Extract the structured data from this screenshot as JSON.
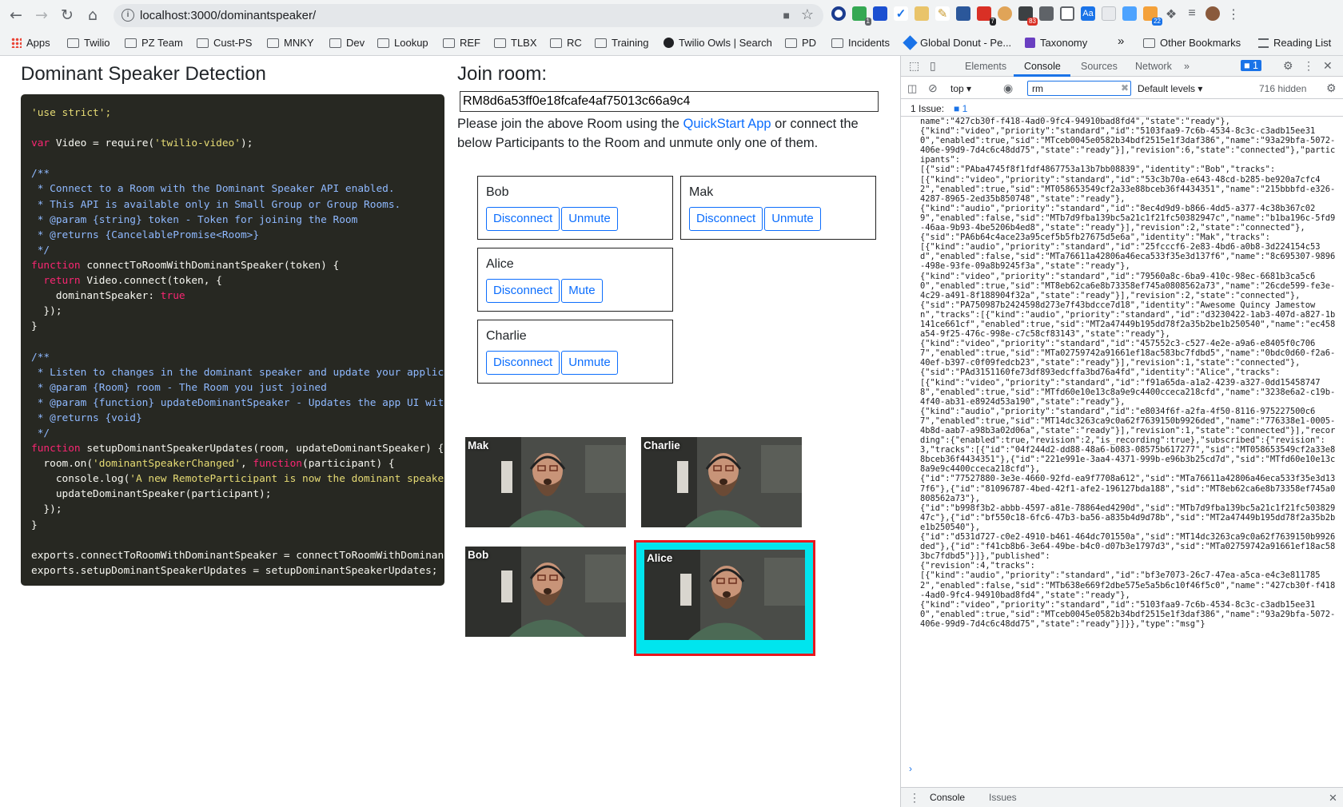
{
  "browser": {
    "url": "localhost:3000/dominantspeaker/",
    "bookmarks": [
      "Apps",
      "Twilio",
      "PZ Team",
      "Cust-PS",
      "MNKY",
      "Dev",
      "Lookup",
      "REF",
      "TLBX",
      "RC",
      "Training",
      "Twilio Owls | Search",
      "PD",
      "Incidents",
      "Global Donut - Pe...",
      "Taxonomy"
    ],
    "bookmarks_right": {
      "overflow": "»",
      "other": "Other Bookmarks",
      "reading": "Reading List"
    },
    "extension_badges": {
      "calendar": "83",
      "todo": "7",
      "rss": "22",
      "ext1": "1"
    }
  },
  "page": {
    "title": "Dominant Speaker Detection",
    "code": [
      [
        [
          "str",
          "'use strict';"
        ]
      ],
      [],
      [
        [
          "kw",
          "var "
        ],
        [
          "plain",
          "Video = "
        ],
        [
          "plain",
          "require("
        ],
        [
          "str",
          "'twilio-video'"
        ],
        [
          "plain",
          ");"
        ]
      ],
      [],
      [
        [
          "com",
          "/**"
        ]
      ],
      [
        [
          "com",
          " * Connect to a Room with the Dominant Speaker API enabled."
        ]
      ],
      [
        [
          "com",
          " * This API is available only in Small Group or Group Rooms."
        ]
      ],
      [
        [
          "com",
          " * @param {string} token - Token for joining the Room"
        ]
      ],
      [
        [
          "com",
          " * @returns {CancelablePromise<Room>}"
        ]
      ],
      [
        [
          "com",
          " */"
        ]
      ],
      [
        [
          "kw",
          "function "
        ],
        [
          "plain",
          "connectToRoomWithDominantSpeaker(token) {"
        ]
      ],
      [
        [
          "kw",
          "  return "
        ],
        [
          "plain",
          "Video.connect(token, {"
        ]
      ],
      [
        [
          "plain",
          "    dominantSpeaker: "
        ],
        [
          "kw",
          "true"
        ]
      ],
      [
        [
          "plain",
          "  });"
        ]
      ],
      [
        [
          "plain",
          "}"
        ]
      ],
      [],
      [
        [
          "com",
          "/**"
        ]
      ],
      [
        [
          "com",
          " * Listen to changes in the dominant speaker and update your application."
        ]
      ],
      [
        [
          "com",
          " * @param {Room} room - The Room you just joined"
        ]
      ],
      [
        [
          "com",
          " * @param {function} updateDominantSpeaker - Updates the app UI with the new dominant speaker"
        ]
      ],
      [
        [
          "com",
          " * @returns {void}"
        ]
      ],
      [
        [
          "com",
          " */"
        ]
      ],
      [
        [
          "kw",
          "function "
        ],
        [
          "plain",
          "setupDominantSpeakerUpdates(room, updateDominantSpeaker) {"
        ]
      ],
      [
        [
          "plain",
          "  room.on("
        ],
        [
          "str",
          "'dominantSpeakerChanged'"
        ],
        [
          "plain",
          ", "
        ],
        [
          "kw",
          "function"
        ],
        [
          "plain",
          "(participant) {"
        ]
      ],
      [
        [
          "plain",
          "    console.log("
        ],
        [
          "str",
          "'A new RemoteParticipant is now the dominant speaker:'"
        ],
        [
          "plain",
          ", participant);"
        ]
      ],
      [
        [
          "plain",
          "    updateDominantSpeaker(participant);"
        ]
      ],
      [
        [
          "plain",
          "  });"
        ]
      ],
      [
        [
          "plain",
          "}"
        ]
      ],
      [],
      [
        [
          "plain",
          "exports.connectToRoomWithDominantSpeaker = connectToRoomWithDominantSpeaker;"
        ]
      ],
      [
        [
          "plain",
          "exports.setupDominantSpeakerUpdates = setupDominantSpeakerUpdates;"
        ]
      ]
    ],
    "join": {
      "title": "Join room:",
      "room_sid": "RM8d6a53ff0e18fcafe4af75013c66a9c4",
      "help_before": "Please join the above Room using the ",
      "help_link": "QuickStart App",
      "help_after": " or connect the below Participants to the Room and unmute only one of them."
    },
    "participants": [
      {
        "name": "Bob",
        "disconnect": "Disconnect",
        "toggle": "Unmute"
      },
      {
        "name": "Mak",
        "disconnect": "Disconnect",
        "toggle": "Unmute"
      },
      {
        "name": "Alice",
        "disconnect": "Disconnect",
        "toggle": "Mute"
      },
      {
        "name": "Charlie",
        "disconnect": "Disconnect",
        "toggle": "Unmute"
      }
    ],
    "videos": [
      {
        "label": "Mak",
        "dominant": false
      },
      {
        "label": "Charlie",
        "dominant": false
      },
      {
        "label": "Bob",
        "dominant": false
      },
      {
        "label": "Alice",
        "dominant": true
      }
    ],
    "colors": {
      "accent": "#0d6efd",
      "dominant_border": "#e8181f",
      "dominant_fill": "#00e5ee",
      "code_bg": "#272822"
    }
  },
  "devtools": {
    "tabs": [
      "Elements",
      "Console",
      "Sources",
      "Network"
    ],
    "active_tab": "Console",
    "issue_count_badge": "1",
    "context": "top",
    "filter": "rm",
    "levels": "Default levels",
    "hidden": "716 hidden",
    "issues_label": "1 Issue:",
    "issues_count": "1",
    "console_text": "name\":\"427cb30f-f418-4ad0-9fc4-94910bad8fd4\",\"state\":\"ready\"},\n{\"kind\":\"video\",\"priority\":\"standard\",\"id\":\"5103faa9-7c6b-4534-8c3c-c3adb15ee310\",\"enabled\":true,\"sid\":\"MTceb0045e0582b34bdf2515e1f3daf386\",\"name\":\"93a29bfa-5072-406e-99d9-7d4c6c48dd75\",\"state\":\"ready\"}],\"revision\":6,\"state\":\"connected\"},\"participants\":\n[{\"sid\":\"PAba4745f8f1fdf4867753a13b7bb08839\",\"identity\":\"Bob\",\"tracks\":\n[{\"kind\":\"video\",\"priority\":\"standard\",\"id\":\"53c3b70a-e643-48cd-b285-be920a7cfc42\",\"enabled\":true,\"sid\":\"MT058653549cf2a33e88bceb36f4434351\",\"name\":\"215bbbfd-e326-4287-8965-2ed35b850748\",\"state\":\"ready\"},\n{\"kind\":\"audio\",\"priority\":\"standard\",\"id\":\"8ec4d9d9-b866-4dd5-a377-4c38b367c029\",\"enabled\":false,\"sid\":\"MTb7d9fba139bc5a21c1f21fc50382947c\",\"name\":\"b1ba196c-5fd9-46aa-9b93-4be5206b4ed8\",\"state\":\"ready\"}],\"revision\":2,\"state\":\"connected\"},\n{\"sid\":\"PA6b64c4ace23a95cef5b5fb27675d5e6a\",\"identity\":\"Mak\",\"tracks\":\n[{\"kind\":\"audio\",\"priority\":\"standard\",\"id\":\"25fcccf6-2e83-4bd6-a0b8-3d224154c53d\",\"enabled\":false,\"sid\":\"MTa76611a42806a46eca533f35e3d137f6\",\"name\":\"8c695307-9896-498e-93fe-09a8b9245f3a\",\"state\":\"ready\"},\n{\"kind\":\"video\",\"priority\":\"standard\",\"id\":\"79560a8c-6ba9-410c-98ec-6681b3ca5c60\",\"enabled\":true,\"sid\":\"MT8eb62ca6e8b73358ef745a0808562a73\",\"name\":\"26cde599-fe3e-4c29-a491-8f188904f32a\",\"state\":\"ready\"}],\"revision\":2,\"state\":\"connected\"},\n{\"sid\":\"PA750987b2424598d273e7f43bdcce7d18\",\"identity\":\"Awesome Quincy Jamestown\",\"tracks\":[{\"kind\":\"audio\",\"priority\":\"standard\",\"id\":\"d3230422-1ab3-407d-a827-1b141ce661cf\",\"enabled\":true,\"sid\":\"MT2a47449b195dd78f2a35b2be1b250540\",\"name\":\"ec458a54-9f25-476c-998e-c7c58cf83143\",\"state\":\"ready\"},\n{\"kind\":\"video\",\"priority\":\"standard\",\"id\":\"457552c3-c527-4e2e-a9a6-e8405f0c7067\",\"enabled\":true,\"sid\":\"MTa02759742a91661ef18ac583bc7fdbd5\",\"name\":\"0bdc0d60-f2a6-40ef-b397-c0f09fedcb23\",\"state\":\"ready\"}],\"revision\":1,\"state\":\"connected\"},\n{\"sid\":\"PAd3151160fe73df893edcffa3bd76a4fd\",\"identity\":\"Alice\",\"tracks\":\n[{\"kind\":\"video\",\"priority\":\"standard\",\"id\":\"f91a65da-a1a2-4239-a327-0dd154587478\",\"enabled\":true,\"sid\":\"MTfd60e10e13c8a9e9c4400cceca218cfd\",\"name\":\"3238e6a2-c19b-4f40-ab31-e8924d53a190\",\"state\":\"ready\"},\n{\"kind\":\"audio\",\"priority\":\"standard\",\"id\":\"e8034f6f-a2fa-4f50-8116-975227500c67\",\"enabled\":true,\"sid\":\"MT14dc3263ca9c0a62f7639150b9926ded\",\"name\":\"776338e1-0005-4b8d-aab7-a98b3a02d06a\",\"state\":\"ready\"}],\"revision\":1,\"state\":\"connected\"}],\"recording\":{\"enabled\":true,\"revision\":2,\"is_recording\":true},\"subscribed\":{\"revision\":3,\"tracks\":[{\"id\":\"04f244d2-dd88-48a6-b083-08575b617277\",\"sid\":\"MT058653549cf2a33e88bceb36f4434351\"},{\"id\":\"221e991e-3aa4-4371-999b-e96b3b25cd7d\",\"sid\":\"MTfd60e10e13c8a9e9c4400cceca218cfd\"},\n{\"id\":\"77527880-3e3e-4660-92fd-ea9f7708a612\",\"sid\":\"MTa76611a42806a46eca533f35e3d137f6\"},{\"id\":\"81096787-4bed-42f1-afe2-196127bda188\",\"sid\":\"MT8eb62ca6e8b73358ef745a0808562a73\"},\n{\"id\":\"b998f3b2-abbb-4597-a81e-78864ed4290d\",\"sid\":\"MTb7d9fba139bc5a21c1f21fc50382947c\"},{\"id\":\"bf550c18-6fc6-47b3-ba56-a835b4d9d78b\",\"sid\":\"MT2a47449b195dd78f2a35b2be1b250540\"},\n{\"id\":\"d531d727-c0e2-4910-b461-464dc701550a\",\"sid\":\"MT14dc3263ca9c0a62f7639150b9926ded\"},{\"id\":\"f41cb8b6-3e64-49be-b4c0-d07b3e1797d3\",\"sid\":\"MTa02759742a91661ef18ac583bc7fdbd5\"}]},\"published\":\n{\"revision\":4,\"tracks\":\n[{\"kind\":\"audio\",\"priority\":\"standard\",\"id\":\"bf3e7073-26c7-47ea-a5ca-e4c3e8117852\",\"enabled\":false,\"sid\":\"MTb638e669f2dbe575e5a5b6c10f46f5c0\",\"name\":\"427cb30f-f418-4ad0-9fc4-94910bad8fd4\",\"state\":\"ready\"},\n{\"kind\":\"video\",\"priority\":\"standard\",\"id\":\"5103faa9-7c6b-4534-8c3c-c3adb15ee310\",\"enabled\":true,\"sid\":\"MTceb0045e0582b34bdf2515e1f3daf386\",\"name\":\"93a29bfa-5072-406e-99d9-7d4c6c48dd75\",\"state\":\"ready\"}]}},\"type\":\"msg\"}",
    "drawer_tabs": [
      "Console",
      "Issues"
    ]
  }
}
